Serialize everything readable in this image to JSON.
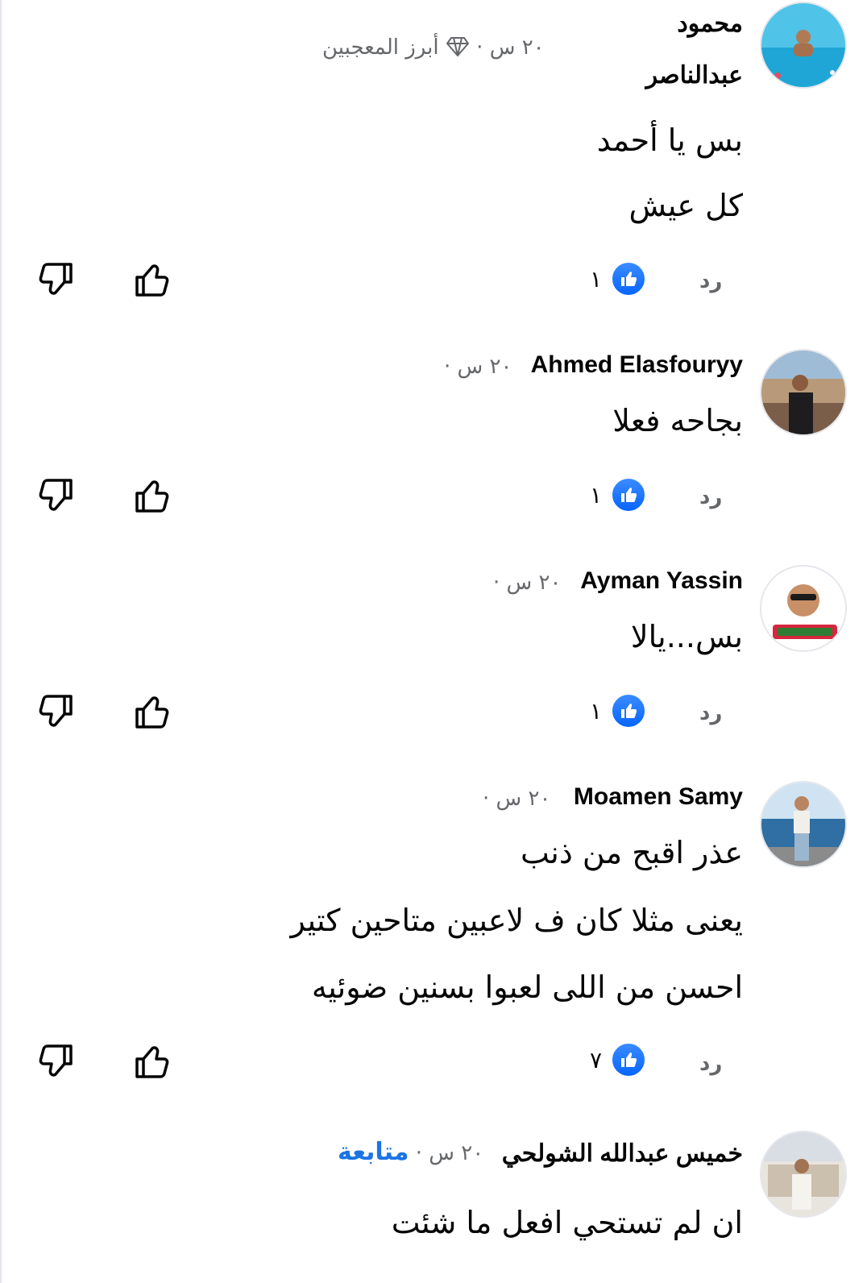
{
  "colors": {
    "link": "#1b74e4",
    "meta": "#65676b",
    "like": "#0866ff"
  },
  "icons": {
    "reaction": "like-thumb-icon",
    "upvote": "thumbs-up-outline-icon",
    "downvote": "thumbs-down-outline-icon",
    "badge": "diamond-icon"
  },
  "comments": [
    {
      "name_line1": "محمود",
      "name_line2": "عبدالناصر",
      "time": "٢٠ س",
      "badge": "أبرز المعجبين",
      "lines": [
        "بس يا أحمد",
        "كل عيش"
      ],
      "reply": "رد",
      "likes": "١"
    },
    {
      "name": "Ahmed Elasfouryy",
      "time": "٢٠ س",
      "lines": [
        "بجاحه فعلا"
      ],
      "reply": "رد",
      "likes": "١"
    },
    {
      "name": "Ayman Yassin",
      "time": "٢٠ س",
      "lines": [
        "بس...يالا"
      ],
      "reply": "رد",
      "likes": "١"
    },
    {
      "name": "Moamen Samy",
      "time": "٢٠ س",
      "lines": [
        "عذر اقبح من ذنب",
        "يعنى مثلا كان ف لاعبين  متاحين كتير",
        "احسن من اللى لعبوا بسنين ضوئيه"
      ],
      "reply": "رد",
      "likes": "٧"
    },
    {
      "name": "خميس عبدالله الشولحي",
      "time": "٢٠ س",
      "follow": "متابعة",
      "lines": [
        "ان لم تستحي افعل ما شئت"
      ]
    }
  ]
}
